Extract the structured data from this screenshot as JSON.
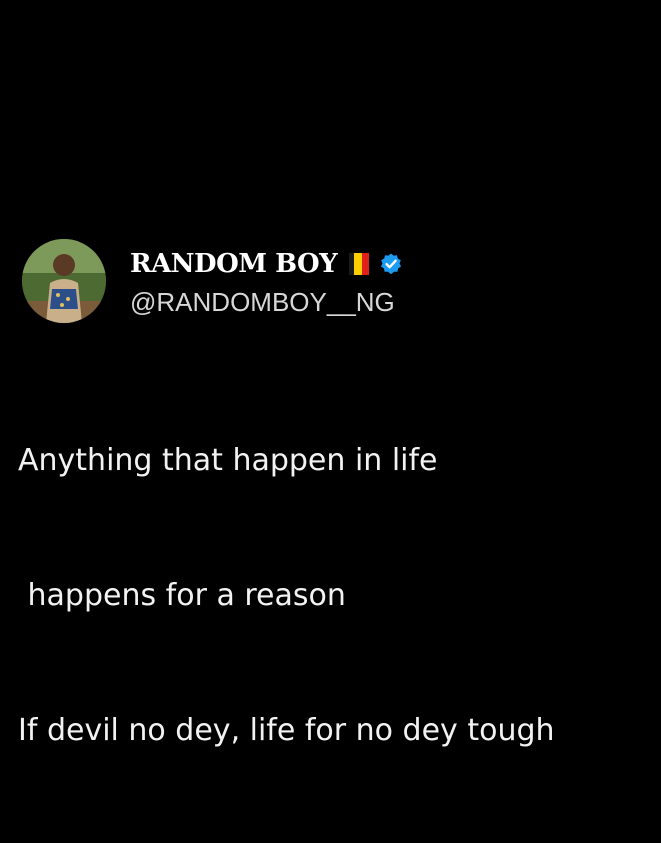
{
  "tweet": {
    "display_name": "RANDOM BOY",
    "handle": "@RANDOMBOY__NG",
    "lines": [
      "Anything that happen in life",
      " happens for a reason",
      "If devil no dey, life for no dey tough"
    ],
    "icons": {
      "avatar": "avatar-photo",
      "flag": "belgium-flag-icon",
      "badge": "verified-badge-icon"
    }
  },
  "colors": {
    "background": "#000000",
    "text": "#ffffff",
    "handle": "#d7d7d7",
    "verified": "#1d9bf0"
  }
}
